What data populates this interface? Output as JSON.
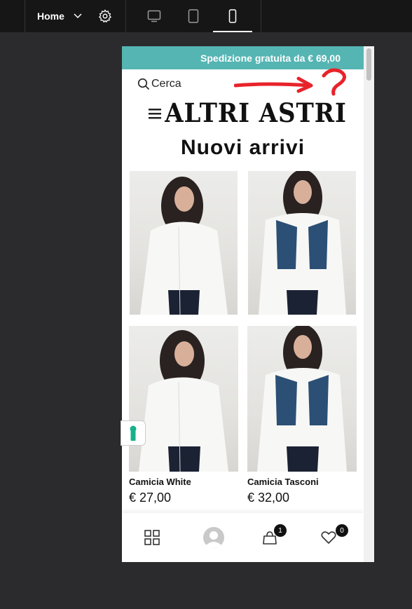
{
  "editor": {
    "page_selector": "Home",
    "device_modes": [
      "desktop",
      "tablet",
      "mobile"
    ],
    "active_device": "mobile"
  },
  "store": {
    "announcement": "Spedizione gratuita da € 69,00",
    "search_label": "Cerca",
    "logo_text": "ALTRI ASTRI",
    "section_title": "Nuovi arrivi",
    "products": [
      {
        "name": "",
        "price": ""
      },
      {
        "name": "",
        "price": ""
      },
      {
        "name": "Camicia White",
        "price": "€ 27,00"
      },
      {
        "name": "Camicia Tasconi",
        "price": "€ 32,00"
      }
    ],
    "cart_count": "1",
    "wishlist_count": "0"
  },
  "colors": {
    "accent": "#55b5b3",
    "annotation": "#e8232a",
    "editor_bg": "#2b2b2d",
    "topbar_bg": "#161616"
  }
}
